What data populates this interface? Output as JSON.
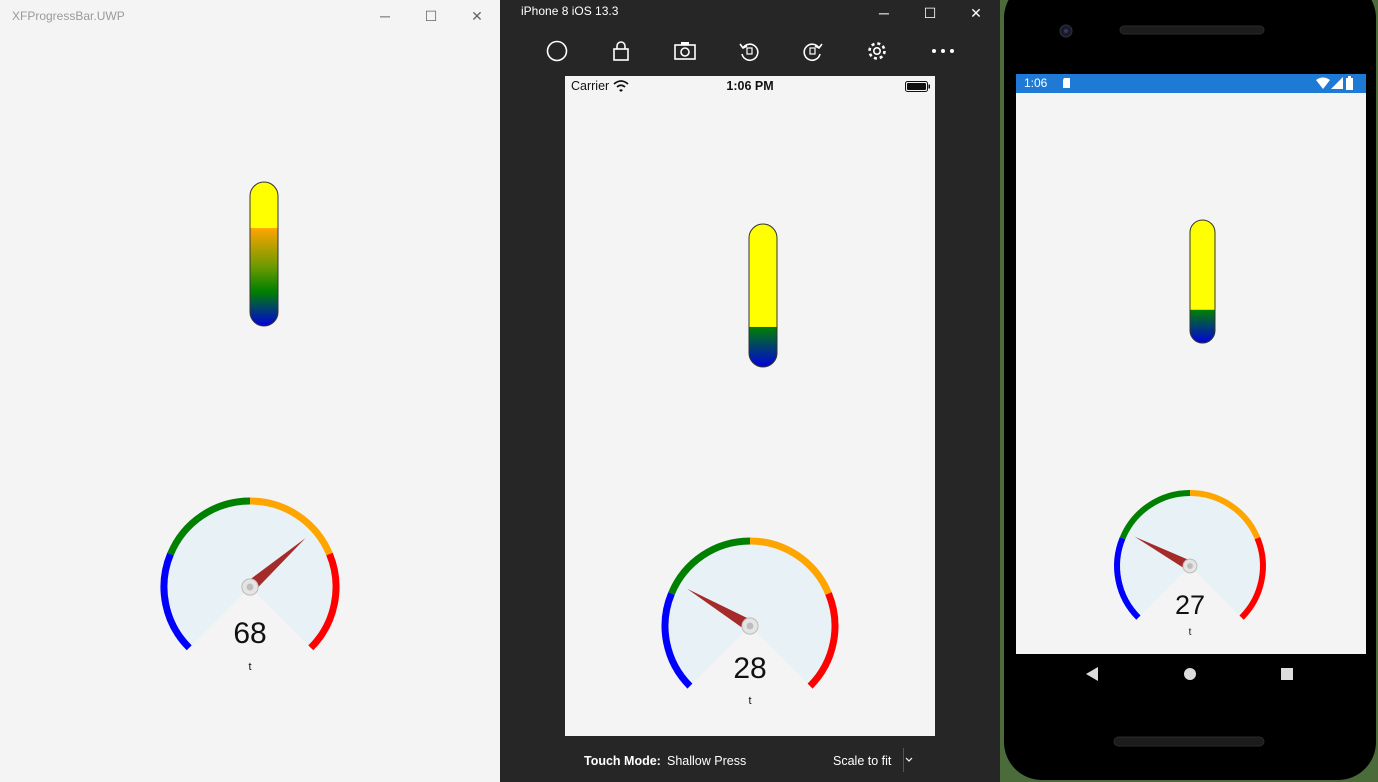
{
  "uwp": {
    "title": "XFProgressBar.UWP",
    "controls": {
      "minimize": "─",
      "maximize": "☐",
      "close": "✕"
    },
    "progress_fraction": 0.68,
    "gauge": {
      "value": "68",
      "label": "t",
      "needle_percent": 68
    }
  },
  "ios": {
    "title": "iPhone 8 iOS 13.3",
    "controls": {
      "minimize": "─",
      "maximize": "☐",
      "close": "✕"
    },
    "status": {
      "carrier": "Carrier",
      "time": "1:06 PM"
    },
    "progress_fraction": 0.28,
    "gauge": {
      "value": "28",
      "label": "t",
      "needle_percent": 28
    },
    "bottom": {
      "touch_mode_label": "Touch Mode:",
      "touch_mode_value": "Shallow Press",
      "scale": "Scale to fit"
    }
  },
  "android": {
    "status": {
      "time": "1:06"
    },
    "progress_fraction": 0.27,
    "gauge": {
      "value": "27",
      "label": "t",
      "needle_percent": 27
    }
  },
  "colors": {
    "blue": "#0000ff",
    "green": "#008000",
    "orange": "#ffa500",
    "red": "#ff0000",
    "yellow": "#ffff00",
    "needle": "#a52a2a",
    "gauge_face": "#e8f2f6"
  }
}
